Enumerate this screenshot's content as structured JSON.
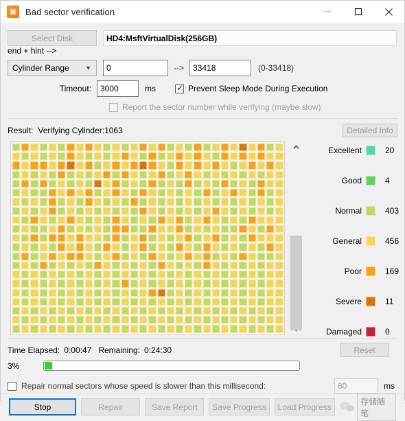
{
  "window": {
    "title": "Bad sector verification",
    "icon": "app-logo-icon",
    "minimize": "–",
    "maximize": "□",
    "close": "✕"
  },
  "disk": {
    "select_disk_label": "Select Disk",
    "disk_value": "HD4:MsftVirtualDisk(256GB)"
  },
  "range": {
    "mode": "Cylinder Range",
    "start": "0",
    "arrow": "-->",
    "end": "33418",
    "hint": "(0-33418)"
  },
  "timeout": {
    "label": "Timeout:",
    "value": "3000",
    "unit": "ms"
  },
  "options": {
    "prevent_sleep": "Prevent Sleep Mode During Execution",
    "prevent_sleep_checked": true,
    "report_sector": "Report the sector number while verifying (maybe slow)",
    "report_sector_checked": false
  },
  "result": {
    "label": "Result:",
    "status": "Verifying Cylinder:1063",
    "detailed_info": "Detailed Info"
  },
  "legend": [
    {
      "name": "Excellent",
      "color": "#4fd8b0",
      "count": "20"
    },
    {
      "name": "Good",
      "color": "#5fd35f",
      "count": "4"
    },
    {
      "name": "Normal",
      "color": "#c2da62",
      "count": "403"
    },
    {
      "name": "General",
      "color": "#f2d659",
      "count": "456"
    },
    {
      "name": "Poor",
      "color": "#f5a419",
      "count": "169"
    },
    {
      "name": "Severe",
      "color": "#d9760a",
      "count": "11"
    },
    {
      "name": "Damaged",
      "color": "#c0243c",
      "count": "0"
    }
  ],
  "timing": {
    "elapsed_label": "Time Elapsed:",
    "elapsed": "0:00:47",
    "remaining_label": "Remaining:",
    "remaining": "0:24:30",
    "reset": "Reset"
  },
  "progress": {
    "percent_text": "3%",
    "percent": 3
  },
  "repair": {
    "label": "Repair normal sectors whose speed is slower than this millisecond:",
    "checked": false,
    "threshold": "80",
    "unit": "ms"
  },
  "footer": {
    "stop": "Stop",
    "repair": "Repair",
    "save_report": "Save Report",
    "save_progress": "Save Progress",
    "load_progress": "Load Progress",
    "watermark": "存储随笔"
  },
  "scrollbar": {
    "up": "⌃",
    "down": "⌄"
  },
  "map": {
    "columns": 30,
    "rows": 23,
    "palette": {
      "e": "#4fd8b0",
      "g": "#5fd35f",
      "n": "#c2da62",
      "r": "#f2d659",
      "p": "#f5a419",
      "s": "#d9760a",
      "d": "#c0243c",
      "u": "#ececec"
    },
    "cells": [
      "nprnrnprprnrnrprpnrnpnrprsrpn",
      "rnrnrnprnrnrprnpnrprprnprprpr",
      "prpprpsrpnrprpsprnprprprnrprp",
      "nrnrnpnrnrpnprnrpnrprnrnrnrnr",
      "npnpnrnrnsrpnrnpnrnpnrnpnrnpr",
      "nrnnprprpnrprnprnrnrnpnrprnpn",
      "rnrnpnrnprnrnpnrnrnrnrnrnrnrn",
      "nrnrpnrnrnrnrnprnrnrnrprnrnrn",
      "rnprnrprnrnprnrnprpnrprnrnprr",
      "nrnnrpnrnrnppnnprrpnrnrnnprnp",
      "rnpnpprprrnpnrpnrnrpnrpnrnprr",
      "nrnrnprprnprnrpnrnprnprnrnrnp",
      "npnrprpprnrpnrnprnrprpnrnprnn",
      "nrnpnrnrnprnrnrnprnrnprnrnrnr",
      "rnrnrnrnrnrnrnrnrnrnrnrnrnrnr",
      "rnrnrnrnrnrnpnrnrnrnrnrnrnrnr",
      "rnrnrnrnrnrnrnrpsnrnrnrnrnrnr",
      "rnrnrnrnrnrnrnrnrnrnrnrnrnrnr",
      "nrnrnrnrnrnrnrnrnrnrnrnrnrnrn",
      "rnrnrnrnrnrnrnrnrnrnrnrnrnrnr",
      "nrnrnrnrnrnrnrnrnrnrnrnrnrnrn",
      "rnrnrnrnrnrnrnrnrnrnrnrnrnrnr",
      "nrnrnrnrnrnrnrnrnrnrnrnrnrnru"
    ]
  }
}
